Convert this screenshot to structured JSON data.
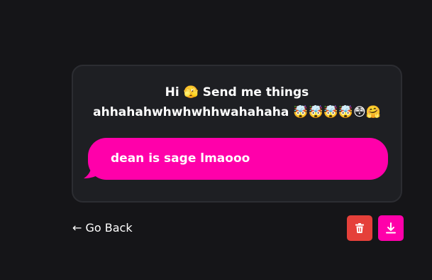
{
  "card": {
    "prompt": "Hi 🫣 Send me things\nahhahahwhwhwhhwahahaha 🤯🤯🤯🤯😳🤗"
  },
  "message": {
    "text": "dean is sage lmaooo"
  },
  "footer": {
    "go_back_label": "← Go Back",
    "delete_icon": "trash-icon",
    "download_icon": "download-icon"
  },
  "colors": {
    "background": "#151518",
    "card": "#1e1f23",
    "accent_pink": "#ff00aa",
    "delete_red": "#e5403a"
  }
}
